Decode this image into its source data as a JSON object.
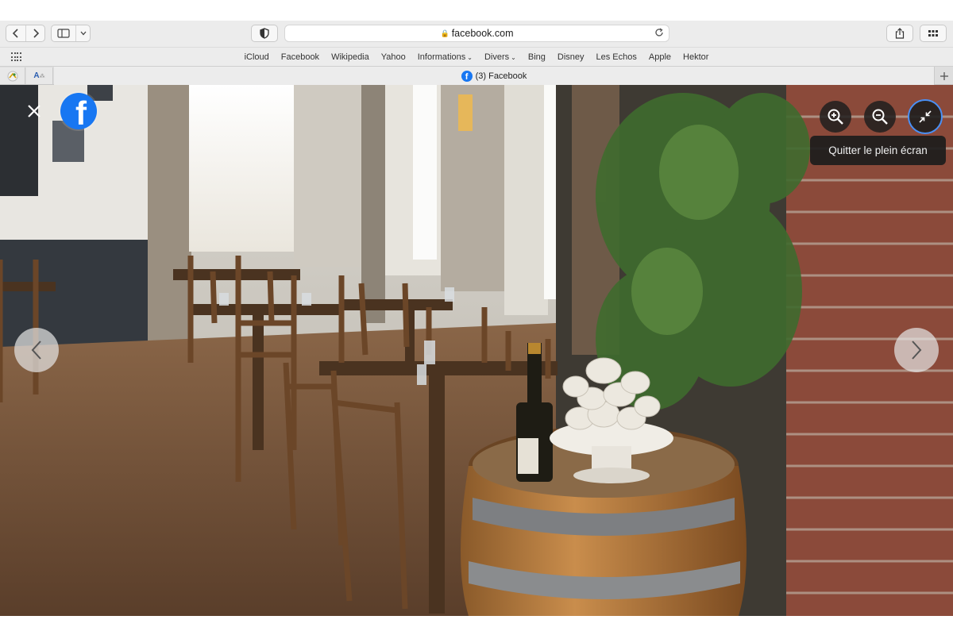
{
  "browser": {
    "url": "facebook.com",
    "favorites": [
      {
        "label": "iCloud",
        "has_menu": false
      },
      {
        "label": "Facebook",
        "has_menu": false
      },
      {
        "label": "Wikipedia",
        "has_menu": false
      },
      {
        "label": "Yahoo",
        "has_menu": false
      },
      {
        "label": "Informations",
        "has_menu": true
      },
      {
        "label": "Divers",
        "has_menu": true
      },
      {
        "label": "Bing",
        "has_menu": false
      },
      {
        "label": "Disney",
        "has_menu": false
      },
      {
        "label": "Les Echos",
        "has_menu": false
      },
      {
        "label": "Apple",
        "has_menu": false
      },
      {
        "label": "Hektor",
        "has_menu": false
      }
    ],
    "pinned_tabs": [
      {
        "icon": "pinned-site-icon"
      },
      {
        "icon": "translate-site-icon",
        "label": "A"
      }
    ],
    "active_tab": {
      "title": "(3) Facebook",
      "icon": "facebook-favicon"
    }
  },
  "viewer": {
    "photo_subject": "restaurant-dining-room-with-wine-barrel",
    "tooltip": "Quitter le plein écran",
    "controls": [
      "close-icon",
      "zoom-in-icon",
      "zoom-out-icon",
      "exit-fullscreen-icon",
      "chevron-left-icon",
      "chevron-right-icon"
    ]
  },
  "colors": {
    "facebook_blue": "#1877f2",
    "focus_ring": "#4a90f5",
    "toolbar_bg": "#ececec"
  }
}
